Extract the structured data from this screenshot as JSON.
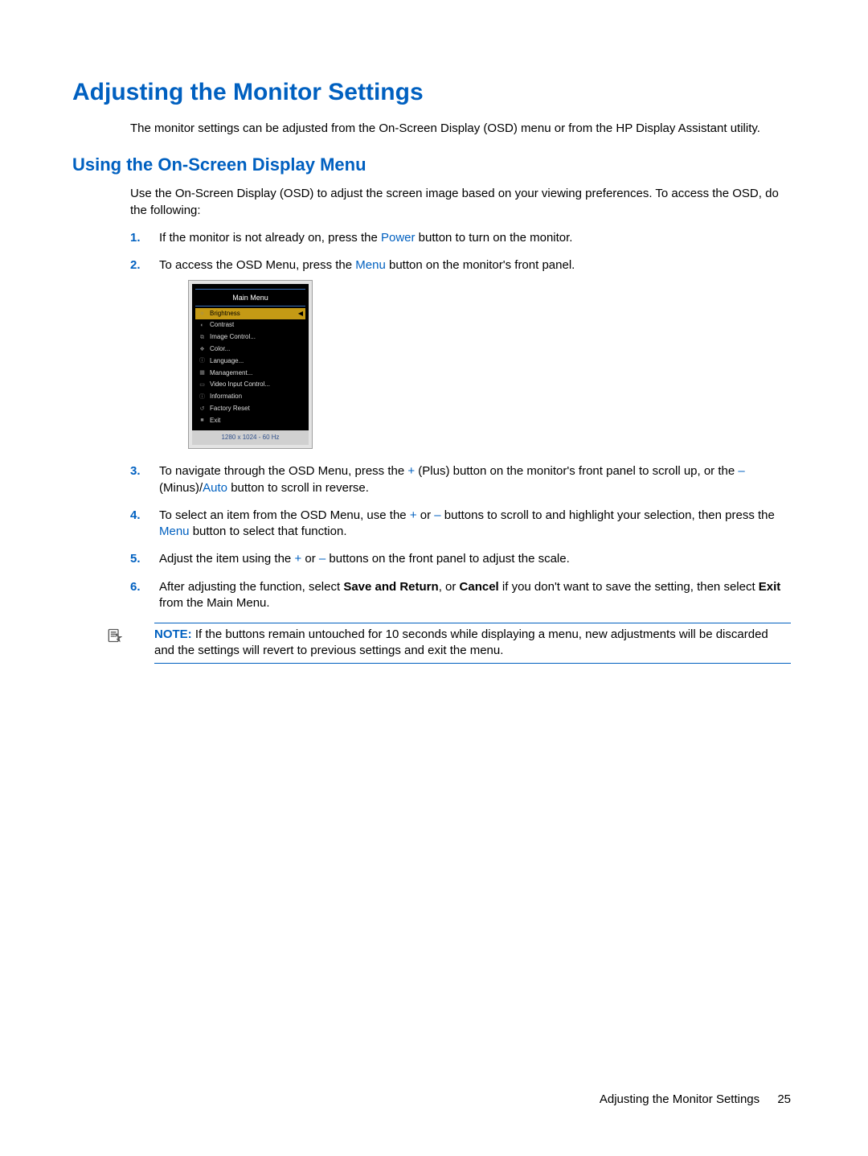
{
  "heading1": "Adjusting the Monitor Settings",
  "intro": "The monitor settings can be adjusted from the On-Screen Display (OSD) menu or from the HP Display Assistant utility.",
  "heading2": "Using the On-Screen Display Menu",
  "intro2": "Use the On-Screen Display (OSD) to adjust the screen image based on your viewing preferences. To access the OSD, do the following:",
  "steps": {
    "s1": {
      "num": "1.",
      "a": "If the monitor is not already on, press the ",
      "kw": "Power",
      "b": " button to turn on the monitor."
    },
    "s2": {
      "num": "2.",
      "a": "To access the OSD Menu, press the ",
      "kw": "Menu",
      "b": " button on the monitor's front panel."
    },
    "s3": {
      "num": "3.",
      "a": "To navigate through the OSD Menu, press the ",
      "plus": "+",
      "b": " (Plus) button on the monitor's front panel to scroll up, or the ",
      "minus": "–",
      "c": " (Minus)/",
      "auto": "Auto",
      "d": " button to scroll in reverse."
    },
    "s4": {
      "num": "4.",
      "a": "To select an item from the OSD Menu, use the ",
      "plus": "+",
      "b": " or ",
      "minus": "–",
      "c": " buttons to scroll to and highlight your selection, then press the ",
      "menu": "Menu",
      "d": " button to select that function."
    },
    "s5": {
      "num": "5.",
      "a": "Adjust the item using the ",
      "plus": "+",
      "b": " or ",
      "minus": "–",
      "c": " buttons on the front panel to adjust the scale."
    },
    "s6": {
      "num": "6.",
      "a": "After adjusting the function, select ",
      "save": "Save and Return",
      "b": ", or ",
      "cancel": "Cancel",
      "c": " if you don't want to save the setting, then select ",
      "exit": "Exit",
      "d": " from the Main Menu."
    }
  },
  "note": {
    "label": "NOTE:",
    "text": " If the buttons remain untouched for 10 seconds while displaying a menu, new adjustments will be discarded and the settings will revert to previous settings and exit the menu."
  },
  "osd": {
    "title": "Main Menu",
    "items": [
      "Brightness",
      "Contrast",
      "Image Control...",
      "Color...",
      "Language...",
      "Management...",
      "Video Input Control...",
      "Information",
      "Factory Reset",
      "Exit"
    ],
    "resolution": "1280 x 1024 - 60 Hz"
  },
  "footer": {
    "section": "Adjusting the Monitor Settings",
    "page": "25"
  }
}
